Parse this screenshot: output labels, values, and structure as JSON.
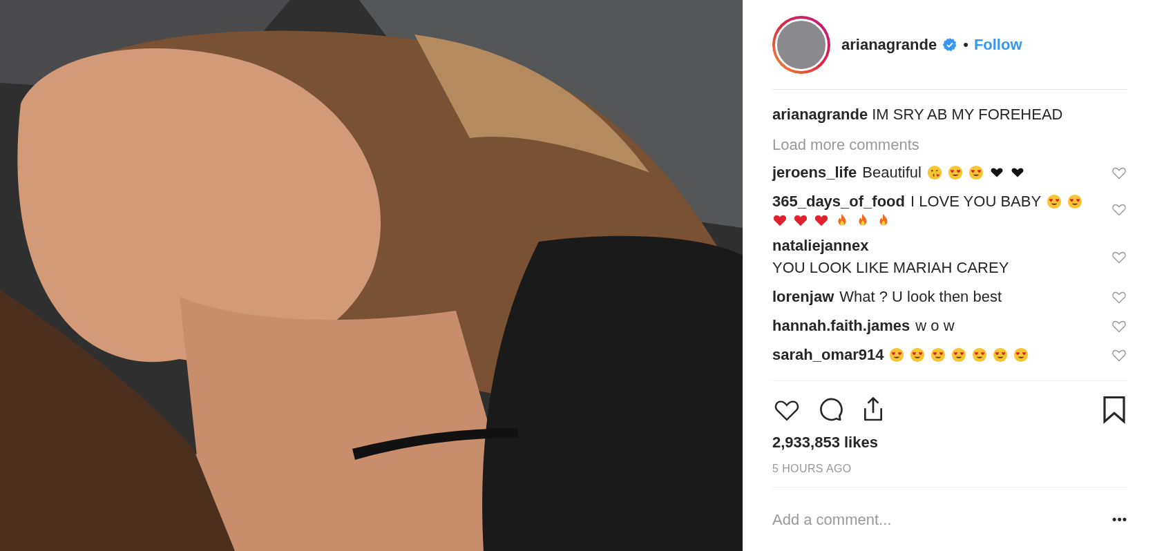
{
  "header": {
    "username": "arianagrande",
    "verified": true,
    "separator": "•",
    "follow": "Follow"
  },
  "caption": {
    "username": "arianagrande",
    "text": "IM SRY AB MY FOREHEAD"
  },
  "load_more": "Load more comments",
  "comments": [
    {
      "username": "jeroens_life",
      "text": "Beautiful",
      "emojis": [
        {
          "kind": "kiss"
        },
        {
          "kind": "heart_eyes"
        },
        {
          "kind": "heart_eyes"
        },
        {
          "kind": "black_heart"
        },
        {
          "kind": "black_heart"
        }
      ],
      "liked": false
    },
    {
      "username": "365_days_of_food",
      "text": "I LOVE YOU BABY",
      "emojis": [
        {
          "kind": "heart_eyes"
        },
        {
          "kind": "heart_eyes"
        },
        {
          "kind": "red_heart"
        },
        {
          "kind": "red_heart"
        },
        {
          "kind": "red_heart"
        },
        {
          "kind": "fire"
        },
        {
          "kind": "fire"
        },
        {
          "kind": "fire"
        }
      ],
      "liked": false
    },
    {
      "username": "nataliejannex",
      "text": "YOU LOOK LIKE MARIAH CAREY",
      "liked": false
    },
    {
      "username": "lorenjaw",
      "text": "What ? U look then best",
      "liked": false
    },
    {
      "username": "hannah.faith.james",
      "text": "w o w",
      "liked": false
    },
    {
      "username": "sarah_omar914",
      "emojis": [
        {
          "kind": "heart_eyes"
        },
        {
          "kind": "heart_eyes"
        },
        {
          "kind": "heart_eyes"
        },
        {
          "kind": "heart_eyes"
        },
        {
          "kind": "heart_eyes"
        },
        {
          "kind": "heart_eyes"
        },
        {
          "kind": "heart_eyes"
        }
      ],
      "liked": false
    }
  ],
  "likes": "2,933,853 likes",
  "time": "5 HOURS AGO",
  "comment_field": {
    "placeholder": "Add a comment..."
  },
  "more": "•••",
  "saved": false
}
